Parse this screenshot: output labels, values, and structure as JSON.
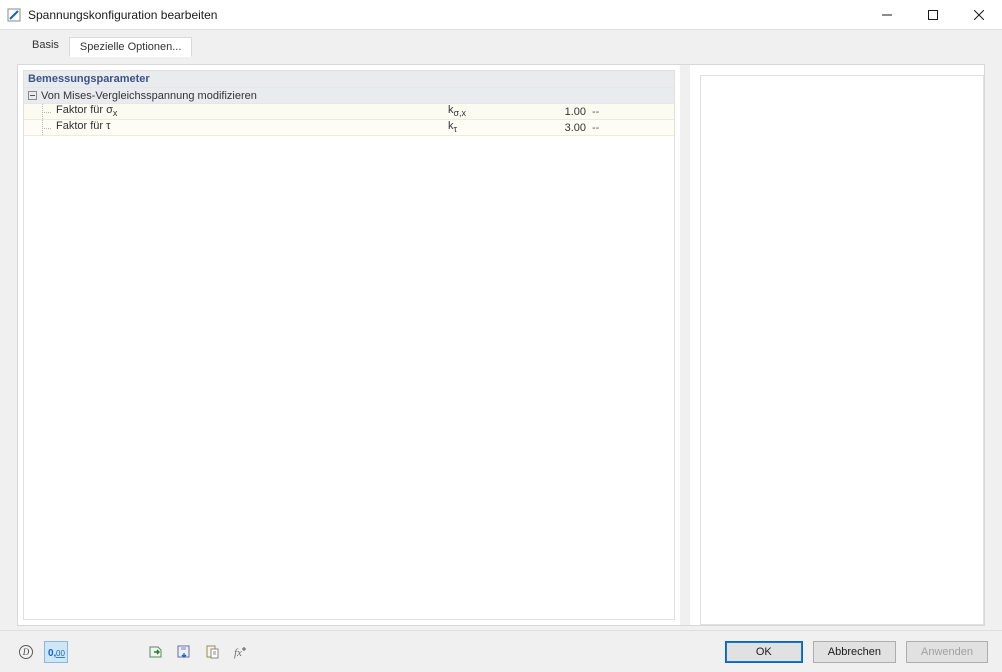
{
  "window": {
    "title": "Spannungskonfiguration bearbeiten"
  },
  "tabs": {
    "basis": "Basis",
    "special": "Spezielle Optionen..."
  },
  "section": {
    "header": "Bemessungsparameter",
    "group": "Von Mises-Vergleichsspannung modifizieren",
    "rows": [
      {
        "label": "Faktor für σ",
        "label_sub": "x",
        "sym": "k",
        "sym_sub": "σ,x",
        "value": "1.00",
        "unit": "--"
      },
      {
        "label": "Faktor für τ",
        "label_sub": "",
        "sym": "k",
        "sym_sub": "τ",
        "value": "3.00",
        "unit": "--"
      }
    ]
  },
  "buttons": {
    "ok": "OK",
    "cancel": "Abbrechen",
    "apply": "Anwenden"
  },
  "icons": {
    "help": "help-icon",
    "units": "units-icon",
    "import": "import-icon",
    "export": "export-icon",
    "clipboard": "clipboard-icon",
    "fx": "function-icon"
  }
}
